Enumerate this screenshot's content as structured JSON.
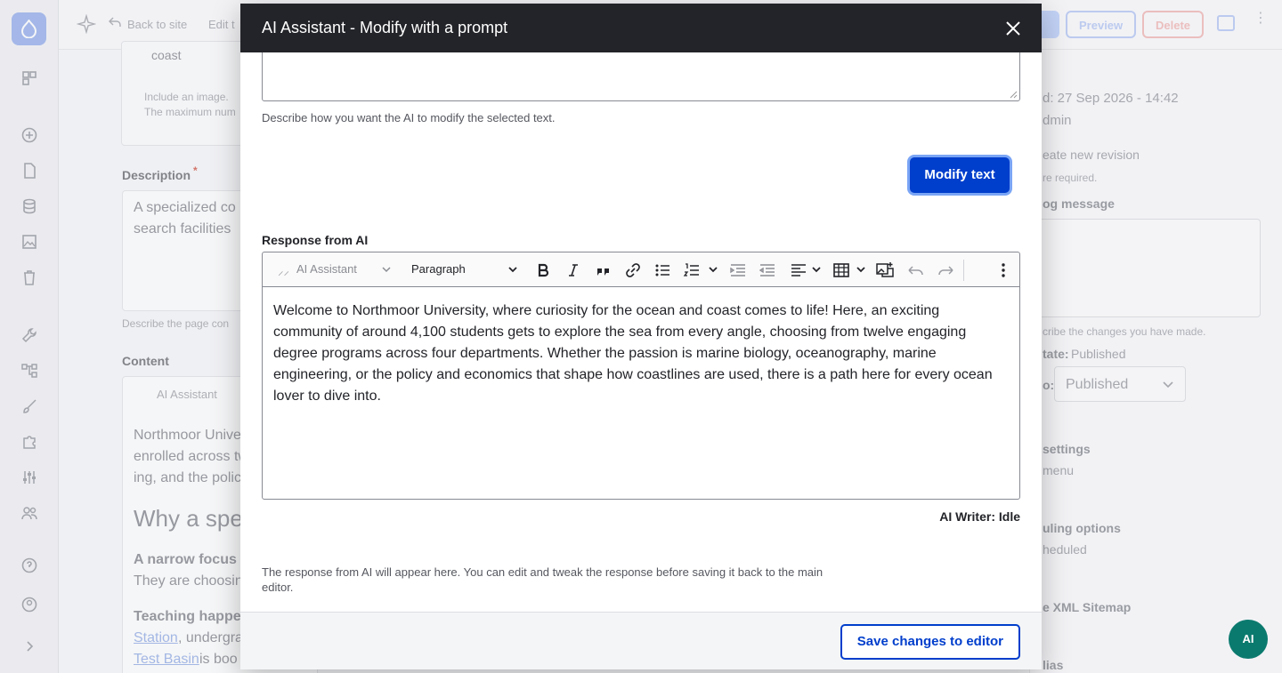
{
  "background": {
    "topbar": {
      "back_label": "Back to site",
      "edit_label": "Edit t",
      "preview_label": "Preview",
      "delete_label": "Delete"
    },
    "main": {
      "coast_tag": "coast",
      "image_help_1": "Include an image.",
      "image_help_2": "The maximum num",
      "description_label": "Description",
      "description_required": "*",
      "description_text_1": "A specialized co",
      "description_text_2": "search facilities",
      "description_help": "Describe the page con",
      "content_label": "Content",
      "content_ai_label": "AI Assistant",
      "content_lines": [
        "Northmoor Unive",
        "enrolled across tw",
        "ing, and the polic"
      ],
      "heading": "Why a spe",
      "bold_1": "A narrow focus",
      "line_1": "They are choosin",
      "bold_2": "Teaching happe",
      "link_1": "Station",
      "link_1_after": ", undergra",
      "link_2": "Test Basin",
      "link_2_after": " is boo"
    },
    "sidebar": {
      "last_saved": "d: 27 Sep 2026 - 14:42",
      "author": "dmin",
      "create_revision": "eate new revision",
      "required_note": "re required.",
      "log_message": "og message",
      "describe_changes": "cribe the changes you have made.",
      "state_label": "tate:",
      "state_value": "Published",
      "select_prefix": "o:",
      "select_value": "Published",
      "settings": "settings",
      "menu": "menu",
      "scheduling": "uling options",
      "scheduled": "heduled",
      "sitemap": "e XML Sitemap",
      "alias": "lias"
    },
    "fab_label": "AI"
  },
  "modal": {
    "title": "AI Assistant - Modify with a prompt",
    "prompt_help": "Describe how you want the AI to modify the selected text.",
    "modify_button": "Modify text",
    "response_label": "Response from AI",
    "toolbar": {
      "ai_assistant": "AI Assistant",
      "paragraph": "Paragraph"
    },
    "response_text": "Welcome to Northmoor University, where curiosity for the ocean and coast comes to life! Here, an exciting community of around 4,100 students gets to explore the sea from every angle, choosing from twelve engaging degree programs across four departments. Whether the passion is marine biology, oceanography, marine engineering, or the policy and economics that shape how coastlines are used, there is a path here for every ocean lover to dive into.",
    "status": "AI Writer: Idle",
    "response_help": "The response from AI will appear here. You can edit and tweak the response before saving it back to the main editor.",
    "save_button": "Save changes to editor"
  },
  "colors": {
    "primary": "#003ecc",
    "header": "#232429",
    "focus_ring": "#7aa5f5"
  }
}
